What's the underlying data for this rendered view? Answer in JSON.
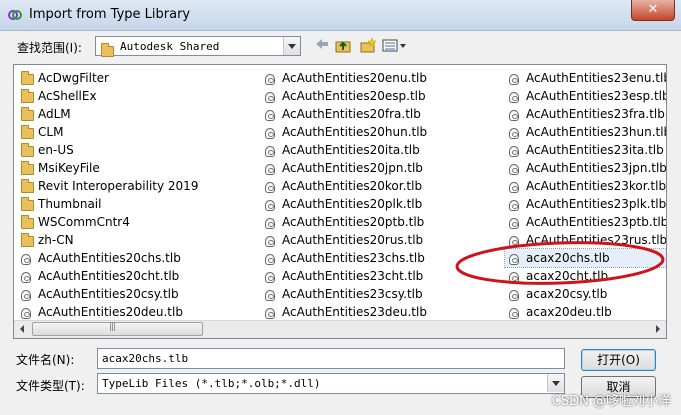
{
  "window": {
    "title": "Import from Type Library",
    "close_label": "✕"
  },
  "lookin": {
    "label": "查找范围(I):",
    "value": "Autodesk Shared"
  },
  "toolbar": {
    "back_icon": "back-arrow-icon",
    "up_icon": "up-folder-icon",
    "newfolder_icon": "new-folder-icon",
    "views_icon": "view-menu-icon"
  },
  "files": {
    "columns": [
      [
        {
          "name": "AcDwgFilter",
          "type": "folder"
        },
        {
          "name": "AcShellEx",
          "type": "folder"
        },
        {
          "name": "AdLM",
          "type": "folder"
        },
        {
          "name": "CLM",
          "type": "folder"
        },
        {
          "name": "en-US",
          "type": "folder"
        },
        {
          "name": "MsiKeyFile",
          "type": "folder"
        },
        {
          "name": "Revit Interoperability 2019",
          "type": "folder"
        },
        {
          "name": "Thumbnail",
          "type": "folder"
        },
        {
          "name": "WSCommCntr4",
          "type": "folder"
        },
        {
          "name": "zh-CN",
          "type": "folder"
        },
        {
          "name": "AcAuthEntities20chs.tlb",
          "type": "file"
        },
        {
          "name": "AcAuthEntities20cht.tlb",
          "type": "file"
        },
        {
          "name": "AcAuthEntities20csy.tlb",
          "type": "file"
        },
        {
          "name": "AcAuthEntities20deu.tlb",
          "type": "file"
        }
      ],
      [
        {
          "name": "AcAuthEntities20enu.tlb",
          "type": "file"
        },
        {
          "name": "AcAuthEntities20esp.tlb",
          "type": "file"
        },
        {
          "name": "AcAuthEntities20fra.tlb",
          "type": "file"
        },
        {
          "name": "AcAuthEntities20hun.tlb",
          "type": "file"
        },
        {
          "name": "AcAuthEntities20ita.tlb",
          "type": "file"
        },
        {
          "name": "AcAuthEntities20jpn.tlb",
          "type": "file"
        },
        {
          "name": "AcAuthEntities20kor.tlb",
          "type": "file"
        },
        {
          "name": "AcAuthEntities20plk.tlb",
          "type": "file"
        },
        {
          "name": "AcAuthEntities20ptb.tlb",
          "type": "file"
        },
        {
          "name": "AcAuthEntities20rus.tlb",
          "type": "file"
        },
        {
          "name": "AcAuthEntities23chs.tlb",
          "type": "file"
        },
        {
          "name": "AcAuthEntities23cht.tlb",
          "type": "file"
        },
        {
          "name": "AcAuthEntities23csy.tlb",
          "type": "file"
        },
        {
          "name": "AcAuthEntities23deu.tlb",
          "type": "file"
        }
      ],
      [
        {
          "name": "AcAuthEntities23enu.tlb",
          "type": "file"
        },
        {
          "name": "AcAuthEntities23esp.tlb",
          "type": "file"
        },
        {
          "name": "AcAuthEntities23fra.tlb",
          "type": "file"
        },
        {
          "name": "AcAuthEntities23hun.tlb",
          "type": "file"
        },
        {
          "name": "AcAuthEntities23ita.tlb",
          "type": "file"
        },
        {
          "name": "AcAuthEntities23jpn.tlb",
          "type": "file"
        },
        {
          "name": "AcAuthEntities23kor.tlb",
          "type": "file"
        },
        {
          "name": "AcAuthEntities23plk.tlb",
          "type": "file"
        },
        {
          "name": "AcAuthEntities23ptb.tlb",
          "type": "file"
        },
        {
          "name": "AcAuthEntities23rus.tlb",
          "type": "file"
        },
        {
          "name": "acax20chs.tlb",
          "type": "file",
          "selected": true
        },
        {
          "name": "acax20cht.tlb",
          "type": "file"
        },
        {
          "name": "acax20csy.tlb",
          "type": "file"
        },
        {
          "name": "acax20deu.tlb",
          "type": "file"
        }
      ]
    ]
  },
  "filename": {
    "label": "文件名(N):",
    "value": "acax20chs.tlb"
  },
  "filetype": {
    "label": "文件类型(T):",
    "value": "TypeLib Files (*.tlb;*.olb;*.dll)"
  },
  "buttons": {
    "open": "打开(O)",
    "cancel": "取消"
  },
  "annotation": {
    "color": "#d0131b"
  },
  "watermark": "CSDN @哆啦刘小洋"
}
